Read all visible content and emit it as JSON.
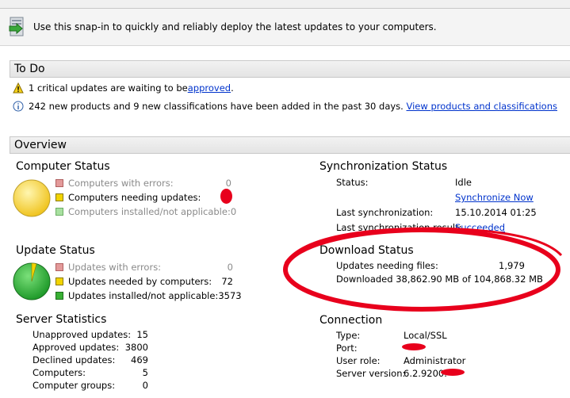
{
  "intro": {
    "text": "Use this snap-in to quickly and reliably deploy the latest updates to your computers."
  },
  "todo": {
    "title": "To Do",
    "item1_text": "1 critical updates are waiting to be ",
    "item1_link": "approved",
    "item1_end": ".",
    "item2_text": "242 new products and 9 new classifications have been added in the past 30 days.",
    "item2_link": "View products and classifications"
  },
  "overview": {
    "title": "Overview",
    "computer_status": {
      "title": "Computer Status",
      "rows": [
        {
          "label": "Computers with errors:",
          "value": "0"
        },
        {
          "label": "Computers needing updates:",
          "value": ""
        },
        {
          "label": "Computers installed/not applicable:",
          "value": "0"
        }
      ]
    },
    "update_status": {
      "title": "Update Status",
      "rows": [
        {
          "label": "Updates with errors:",
          "value": "0"
        },
        {
          "label": "Updates needed by computers:",
          "value": "72"
        },
        {
          "label": "Updates installed/not applicable:",
          "value": "3573"
        }
      ]
    },
    "server_statistics": {
      "title": "Server Statistics",
      "rows": [
        {
          "label": "Unapproved updates:",
          "value": "15"
        },
        {
          "label": "Approved updates:",
          "value": "3800"
        },
        {
          "label": "Declined updates:",
          "value": "469"
        },
        {
          "label": "Computers:",
          "value": "5"
        },
        {
          "label": "Computer groups:",
          "value": "0"
        }
      ]
    },
    "sync_status": {
      "title": "Synchronization Status",
      "status_label": "Status:",
      "status_value": "Idle",
      "sync_now": "Synchronize Now",
      "last_sync_label": "Last synchronization:",
      "last_sync_value": "15.10.2014 01:25",
      "last_result_label": "Last synchronization result:",
      "last_result_value": "Succeeded"
    },
    "download_status": {
      "title": "Download Status",
      "needing_label": "Updates needing files:",
      "needing_value": "1,979",
      "downloaded_text": "Downloaded 38,862.90 MB of 104,868.32 MB"
    },
    "connection": {
      "title": "Connection",
      "type_label": "Type:",
      "type_value": "Local/SSL",
      "port_label": "Port:",
      "role_label": "User role:",
      "role_value": "Administrator",
      "version_label": "Server version:",
      "version_value": "6.2.9200."
    }
  },
  "colors": {
    "error": "#e39a9a",
    "needed": "#f2d400",
    "installed": "#39b034",
    "link": "#0033cc",
    "annotation": "#e8001c"
  }
}
